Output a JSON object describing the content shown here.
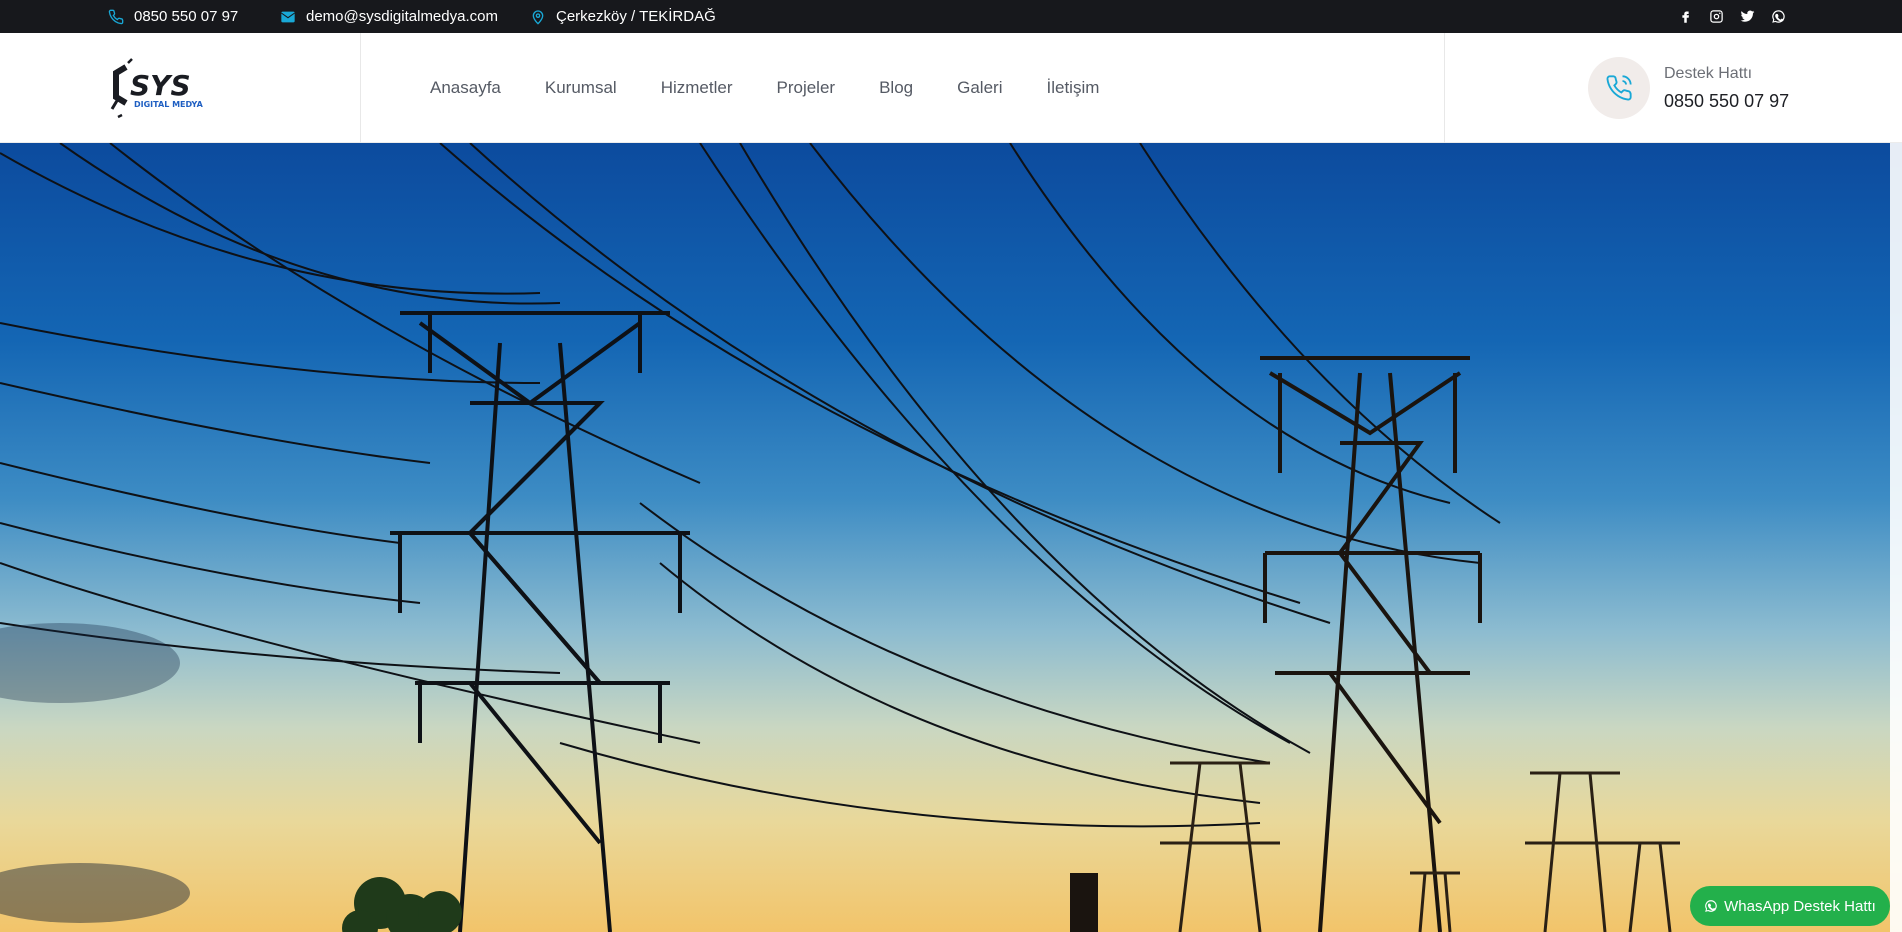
{
  "topbar": {
    "phone": "0850 550 07 97",
    "email": "demo@sysdigitalmedya.com",
    "location": "Çerkezköy / TEKİRDAĞ",
    "social": [
      "facebook-icon",
      "instagram-icon",
      "twitter-icon",
      "whatsapp-icon"
    ]
  },
  "logo": {
    "main": "SYS",
    "sub": "DIGITAL MEDYA"
  },
  "nav": {
    "items": [
      "Anasayfa",
      "Kurumsal",
      "Hizmetler",
      "Projeler",
      "Blog",
      "Galeri",
      "İletişim"
    ]
  },
  "support": {
    "label": "Destek Hattı",
    "number": "0850 550 07 97"
  },
  "whatsapp_button": {
    "label": "WhasApp Destek Hattı"
  },
  "colors": {
    "topbar_bg": "#17181c",
    "accent": "#19a8d6",
    "whatsapp_green": "#23b04b",
    "nav_text": "#555a64"
  }
}
